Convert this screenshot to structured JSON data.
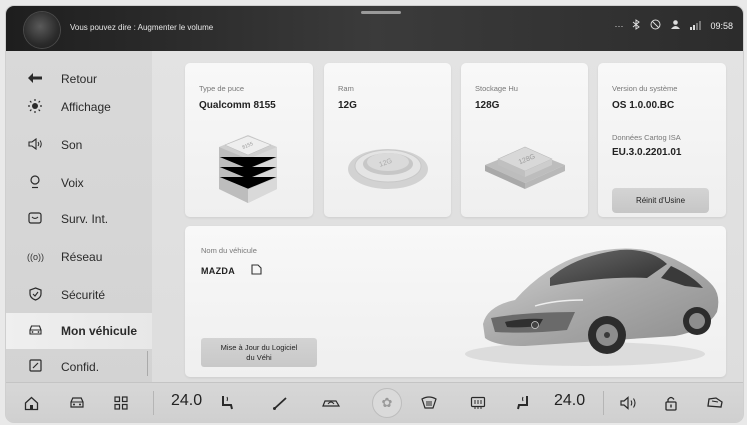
{
  "status_bar": {
    "voice_hint": "Vous pouvez dire : Augmenter le volume",
    "icons": [
      "more-dots-icon",
      "bluetooth-icon",
      "mute-icon",
      "user-icon",
      "signal-icon"
    ],
    "clock": "09:58"
  },
  "sidebar": {
    "back_label": "Retour",
    "items": [
      {
        "label": "Affichage",
        "icon": "brightness-icon"
      },
      {
        "label": "Son",
        "icon": "speaker-icon"
      },
      {
        "label": "Voix",
        "icon": "voice-icon"
      },
      {
        "label": "Surv. Int.",
        "icon": "monitor-icon"
      },
      {
        "label": "Réseau",
        "icon": "network-icon"
      },
      {
        "label": "Sécurité",
        "icon": "shield-icon"
      },
      {
        "label": "Mon véhicule",
        "icon": "car-icon"
      },
      {
        "label": "Confid.",
        "icon": "privacy-icon"
      }
    ],
    "active": "Mon véhicule"
  },
  "info": {
    "chip": {
      "label": "Type de puce",
      "value": "Qualcomm 8155",
      "badge": "8155"
    },
    "ram": {
      "label": "Ram",
      "value": "12G",
      "badge": "12G"
    },
    "storage": {
      "label": "Stockage Hu",
      "value": "128G",
      "badge": "128G"
    },
    "version": {
      "label": "Version du système",
      "value": "OS 1.0.00.BC",
      "cartog_label": "Données Cartog ISA",
      "cartog_value": "EU.3.0.2201.01",
      "reset_label": "Réinit d'Usine"
    }
  },
  "vehicle": {
    "name_label": "Nom du véhicule",
    "name": "MAZDA",
    "update_label": "Mise à Jour du Logiciel du Véhi"
  },
  "dock": {
    "left_temp": "24.0",
    "right_temp": "24.0",
    "icons": [
      "home-icon",
      "car-icon",
      "apps-grid-icon",
      "seat-heat-icon",
      "wiper-icon",
      "air-recirculation-icon",
      "fan-icon",
      "front-defrost-icon",
      "rear-defrost-icon",
      "seat-heat-icon",
      "volume-icon",
      "lock-icon",
      "car-settings-icon"
    ]
  },
  "colors": {
    "status_bar_dark": "#2c2c2c",
    "sidebar": "#d6d6d6",
    "card": "#f4f4f4",
    "active_item": "#ececec"
  }
}
